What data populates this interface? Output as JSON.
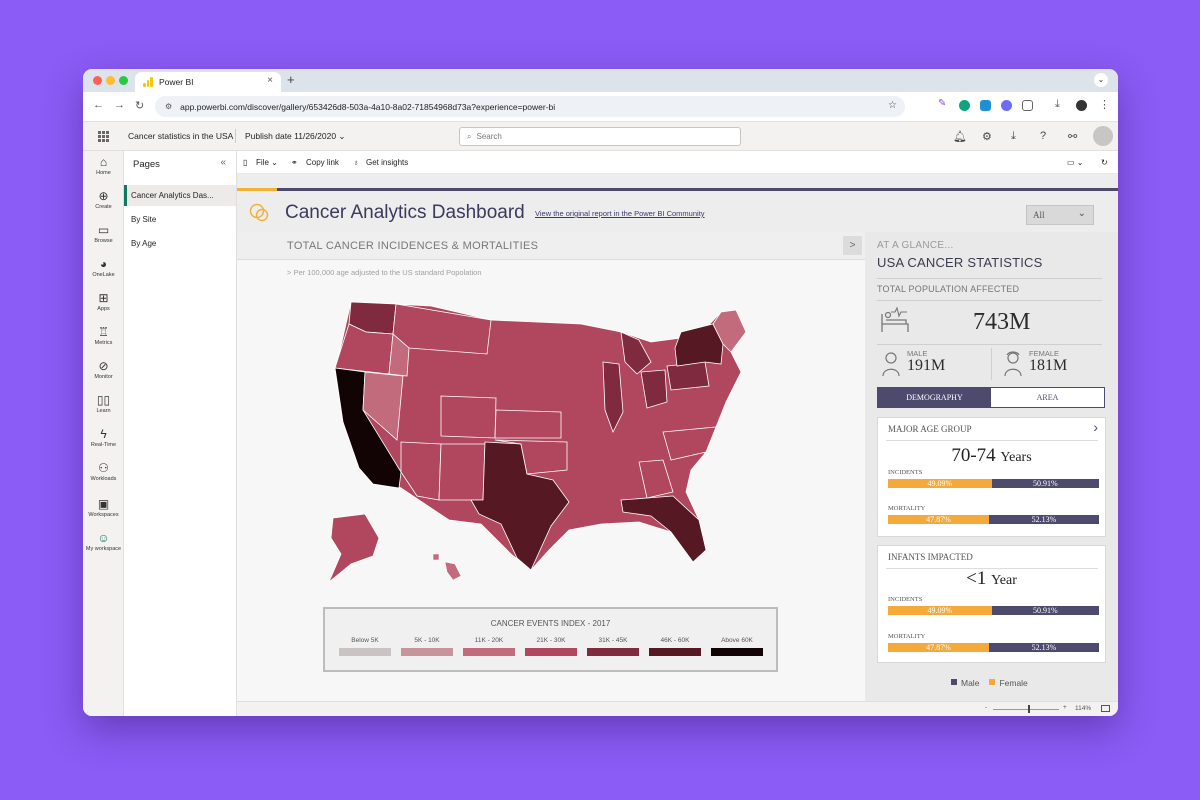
{
  "browser": {
    "tab_title": "Power BI",
    "tab_close": "×",
    "new_tab": "+",
    "tab_menu": "⌄",
    "url": "app.powerbi.com/discover/gallery/653426d8-503a-4a10-8a02-71854968d73a?experience=power-bi"
  },
  "header": {
    "report_name": "Cancer statistics in the USA",
    "publish_date": "Publish date 11/26/2020  ⌄",
    "search_placeholder": "Search"
  },
  "leftnav": [
    {
      "label": "Home",
      "icon": "⌂"
    },
    {
      "label": "Create",
      "icon": "⊕"
    },
    {
      "label": "Browse",
      "icon": "▭"
    },
    {
      "label": "OneLake",
      "icon": "◕"
    },
    {
      "label": "Apps",
      "icon": "⊞"
    },
    {
      "label": "Metrics",
      "icon": "♖"
    },
    {
      "label": "Monitor",
      "icon": "⊘"
    },
    {
      "label": "Learn",
      "icon": "▯▯"
    },
    {
      "label": "Real-Time",
      "icon": "ϟ"
    },
    {
      "label": "Workloads",
      "icon": "⚇"
    },
    {
      "label": "Workspaces",
      "icon": "▣"
    },
    {
      "label": "My workspace",
      "icon": "☺"
    }
  ],
  "pages": {
    "title": "Pages",
    "items": [
      "Cancer Analytics Das...",
      "By Site",
      "By Age"
    ]
  },
  "report_toolbar": {
    "file": "File  ⌄",
    "copy_link": "Copy link",
    "get_insights": "Get insights"
  },
  "dashboard": {
    "title": "Cancer Analytics Dashboard",
    "link": "View the original report in the Power BI Community",
    "filter_value": "All"
  },
  "map_panel": {
    "title": "TOTAL CANCER INCIDENCES & MORTALITIES",
    "subtitle": "> Per 100,000 age adjusted to the US standard Popolation",
    "legend_title": "CANCER EVENTS INDEX - 2017",
    "legend": [
      {
        "label": "Below 5K",
        "color": "#c9c3c4"
      },
      {
        "label": "5K - 10K",
        "color": "#c7949c"
      },
      {
        "label": "11K - 20K",
        "color": "#c26b7c"
      },
      {
        "label": "21K - 30K",
        "color": "#b0475e"
      },
      {
        "label": "31K - 45K",
        "color": "#7f2a3f"
      },
      {
        "label": "46K - 60K",
        "color": "#561823"
      },
      {
        "label": "Above 60K",
        "color": "#120305"
      }
    ]
  },
  "right_panel": {
    "kicker": "AT A GLANCE...",
    "title": "USA CANCER STATISTICS",
    "population_label": "TOTAL POPULATION AFFECTED",
    "total": "743M",
    "male_label": "MALE",
    "male_value": "191M",
    "female_label": "FEMALE",
    "female_value": "181M",
    "tabs": [
      "DEMOGRAPHY",
      "AREA"
    ],
    "age_card": {
      "title": "MAJOR AGE GROUP",
      "value": "70-74",
      "unit": "Years",
      "incidents_label": "INCIDENTS",
      "incidents_female": "49.09%",
      "incidents_male": "50.91%",
      "incidents_female_frac": 0.4909,
      "mortality_label": "MORTALITY",
      "mortality_female": "47.87%",
      "mortality_male": "52.13%",
      "mortality_female_frac": 0.4787
    },
    "infant_card": {
      "title": "INFANTS IMPACTED",
      "value": "<1",
      "unit": "Year",
      "incidents_label": "INCIDENTS",
      "incidents_female": "49.09%",
      "incidents_male": "50.91%",
      "incidents_female_frac": 0.4909,
      "mortality_label": "MORTALITY",
      "mortality_female": "47.87%",
      "mortality_male": "52.13%",
      "mortality_female_frac": 0.4787
    },
    "legend_male": "Male",
    "legend_female": "Female",
    "male_color": "#4e4a6e",
    "female_color": "#f4a93a"
  },
  "statusbar": {
    "zoom": "114%",
    "minus": "-",
    "plus": "+"
  }
}
